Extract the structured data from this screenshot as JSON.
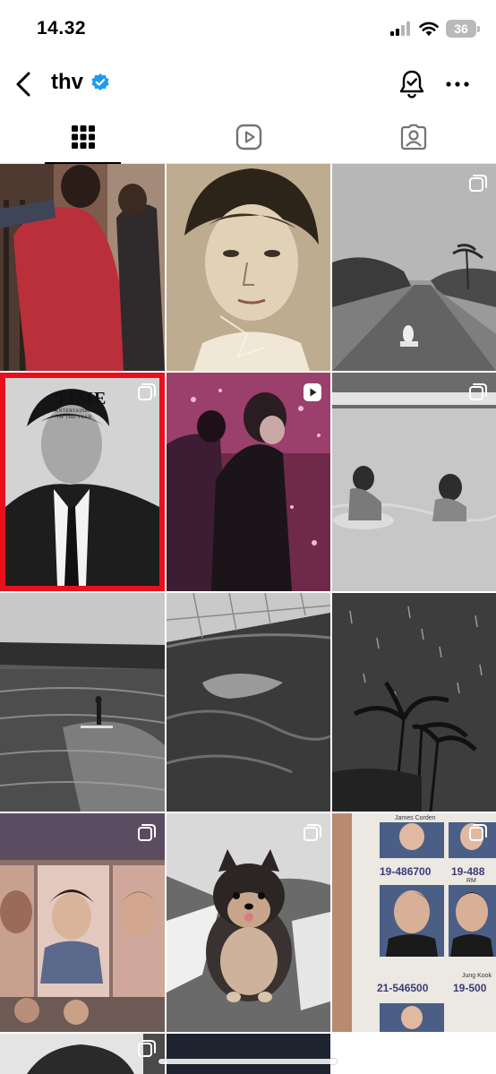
{
  "status_bar": {
    "time": "14.32",
    "battery": "36"
  },
  "header": {
    "username": "thv",
    "verified": true
  },
  "tabs": [
    {
      "icon": "grid-icon",
      "selected": true
    },
    {
      "icon": "reels-icon",
      "selected": false
    },
    {
      "icon": "tagged-icon",
      "selected": false
    }
  ],
  "cover_text": {
    "magazine": "TIME",
    "subtitle_1": "ENTERTAINER",
    "subtitle_2": "OF THE YEAR"
  },
  "photo_sheet": {
    "name_1": "James Corden",
    "number_1": "19-486700",
    "number_2": "19-488",
    "number_3": "21-546500",
    "number_4": "19-500",
    "name_2": "RM",
    "name_3": "Jung Kook"
  },
  "colors": {
    "verified": "#1d9bf0",
    "tab_active": "#000000",
    "tab_inactive": "#737373",
    "cover_border": "#e8101c"
  }
}
